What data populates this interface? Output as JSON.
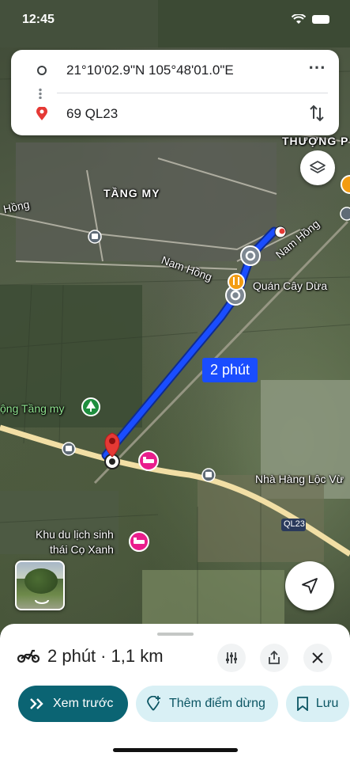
{
  "status_bar": {
    "time": "12:45"
  },
  "directions": {
    "origin": "21°10'02.9\"N 105°48'01.0\"E",
    "destination": "69 QL23"
  },
  "map": {
    "labels": {
      "thuong": "THƯỢNG P",
      "tang_my": "TẦNG MY",
      "hong": "Hồng",
      "nam_hong_1": "Nam Hồng",
      "nam_hong_2": "Nam Hồng",
      "quan_cay_dua": "Quán Cây Dừa",
      "dong_tang_my": "ộng Tầng my",
      "nha_hang": "Nhà Hàng Lộc Vừ",
      "ql23": "QL23",
      "khu_du_lich_1": "Khu du lịch sinh",
      "khu_du_lich_2": "thái Cọ Xanh"
    },
    "route_badge": "2 phút",
    "route_color": "#1a4dff"
  },
  "sheet": {
    "duration": "2 phút",
    "separator": "·",
    "distance": "1,1 km",
    "buttons": {
      "preview": "Xem trước",
      "add_stop": "Thêm điểm dừng",
      "save": "Lưu"
    }
  },
  "colors": {
    "primary": "#0b6473",
    "chip_secondary": "#d9f0f5"
  }
}
